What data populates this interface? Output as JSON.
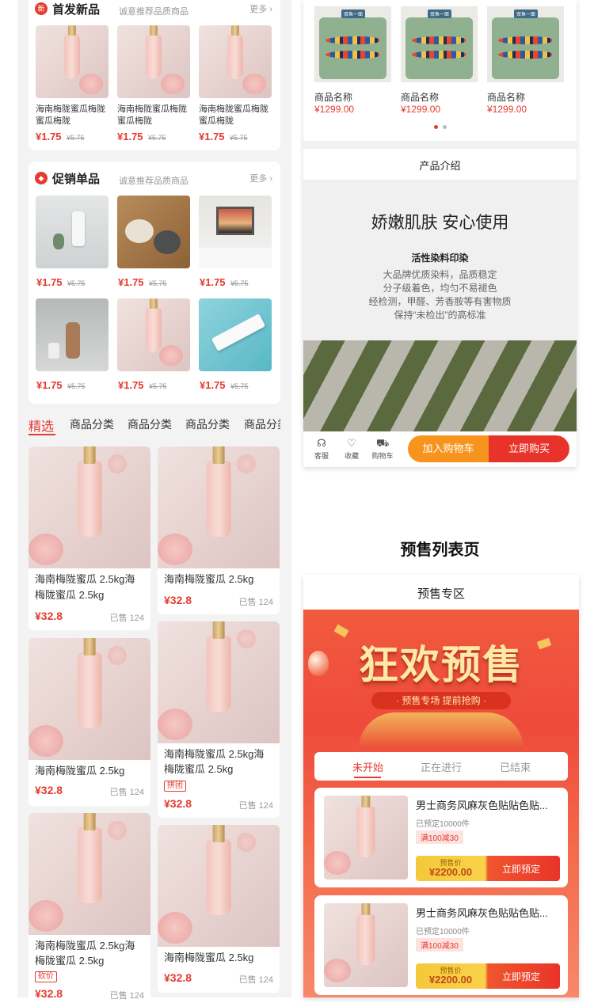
{
  "new_products": {
    "title": "首发新品",
    "subtitle": "诚意推荐品质商品",
    "more": "更多",
    "items": [
      {
        "name": "海南梅陇蜜瓜梅陇蜜瓜梅陇",
        "price": "¥1.75",
        "old_price": "¥5.75"
      },
      {
        "name": "海南梅陇蜜瓜梅陇蜜瓜梅陇",
        "price": "¥1.75",
        "old_price": "¥5.75"
      },
      {
        "name": "海南梅陇蜜瓜梅陇蜜瓜梅陇",
        "price": "¥1.75",
        "old_price": "¥5.75"
      }
    ]
  },
  "promo_products": {
    "title": "促销单品",
    "subtitle": "诚意推荐品质商品",
    "more": "更多",
    "items": [
      {
        "price": "¥1.75",
        "old_price": "¥5.75"
      },
      {
        "price": "¥1.75",
        "old_price": "¥5.75"
      },
      {
        "price": "¥1.75",
        "old_price": "¥5.75"
      },
      {
        "price": "¥1.75",
        "old_price": "¥5.75"
      },
      {
        "price": "¥1.75",
        "old_price": "¥5.75"
      },
      {
        "price": "¥1.75",
        "old_price": "¥5.75"
      }
    ]
  },
  "category_tabs": [
    "精选",
    "商品分类",
    "商品分类",
    "商品分类",
    "商品分类"
  ],
  "grid_products": [
    {
      "name_l1": "海南梅陇蜜瓜 2.5kg海",
      "name_l2": "梅陇蜜瓜 2.5kg",
      "price": "¥32.8",
      "sold": "已售 124",
      "tag": ""
    },
    {
      "name_l1": "海南梅陇蜜瓜 2.5kg",
      "name_l2": "",
      "price": "¥32.8",
      "sold": "已售 124",
      "tag": ""
    },
    {
      "name_l1": "海南梅陇蜜瓜 2.5kg",
      "name_l2": "",
      "price": "¥32.8",
      "sold": "已售 124",
      "tag": ""
    },
    {
      "name_l1": "海南梅陇蜜瓜 2.5kg海",
      "name_l2": "梅陇蜜瓜 2.5kg",
      "price": "¥32.8",
      "sold": "已售 124",
      "tag": "拼团"
    },
    {
      "name_l1": "海南梅陇蜜瓜 2.5kg海",
      "name_l2": "梅陇蜜瓜 2.5kg",
      "price": "¥32.8",
      "sold": "已售 124",
      "tag": "砍价"
    },
    {
      "name_l1": "海南梅陇蜜瓜 2.5kg",
      "name_l2": "",
      "price": "¥32.8",
      "sold": "已售 124",
      "tag": ""
    }
  ],
  "recommend": {
    "items": [
      {
        "name": "商品名称",
        "price": "¥1299.00"
      },
      {
        "name": "商品名称",
        "price": "¥1299.00"
      },
      {
        "name": "商品名称",
        "price": "¥1299.00"
      }
    ],
    "badge": "双鱼一面"
  },
  "intro": {
    "header": "产品介绍",
    "headline": "娇嫩肌肤 安心使用",
    "feature_title": "活性染料印染",
    "lines": [
      "大品牌优质染料，品质稳定",
      "分子级着色，均匀不易褪色",
      "经检测，甲醛、芳香胺等有害物质",
      "保持“未检出”的高标准"
    ]
  },
  "bottom_bar": {
    "service": "客服",
    "favorite": "收藏",
    "cart": "购物车",
    "add_cart": "加入购物车",
    "buy_now": "立即购买"
  },
  "presale_page": {
    "section_title": "预售列表页",
    "header": "预售专区",
    "banner_title": "狂欢预售",
    "banner_sub": "· 预售专场  提前抢购 ·",
    "tabs": [
      "未开始",
      "正在进行",
      "已结束"
    ],
    "items": [
      {
        "title": "男士商务风麻灰色贴贴色贴...",
        "booked": "已预定10000件",
        "promo": "满100减30",
        "price_label": "预售价",
        "price": "¥2200.00",
        "button": "立即预定"
      },
      {
        "title": "男士商务风麻灰色贴贴色贴...",
        "booked": "已预定10000件",
        "promo": "满100减30",
        "price_label": "预售价",
        "price": "¥2200.00",
        "button": "立即预定"
      }
    ]
  },
  "colors": {
    "accent": "#e53a2f",
    "orange": "#f7941d",
    "banner": "#ef4a3c"
  }
}
